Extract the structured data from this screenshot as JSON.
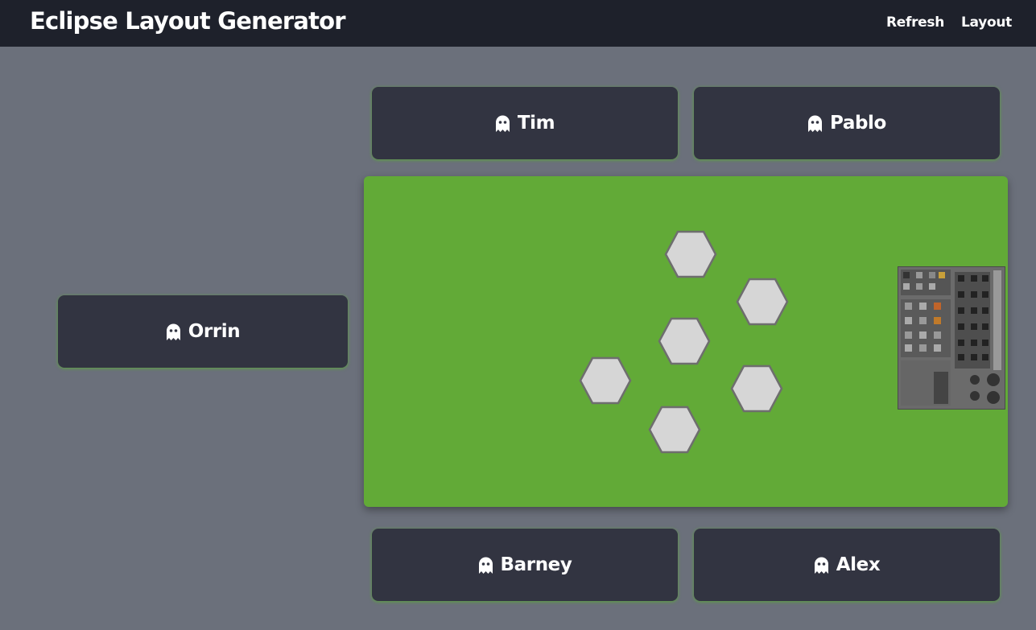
{
  "header": {
    "title": "Eclipse Layout Generator",
    "nav": {
      "refresh_label": "Refresh",
      "layout_label": "Layout"
    }
  },
  "players": {
    "top_left": "Tim",
    "top_right": "Pablo",
    "left": "Orrin",
    "bottom_left": "Barney",
    "bottom_right": "Alex"
  },
  "icons": {
    "player": "ghost-icon",
    "tile": "hex-tile-icon",
    "board": "player-board-icon"
  },
  "colors": {
    "topbar": "#1e212b",
    "page_background": "#6b707b",
    "player_card": "#323441",
    "board_green": "#62aa37",
    "hex_fill": "#d6d6d6"
  }
}
